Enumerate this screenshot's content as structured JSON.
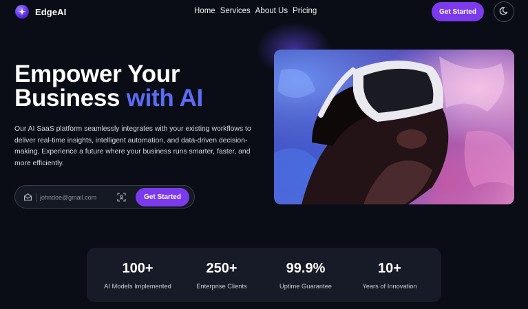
{
  "brand": {
    "name": "EdgeAI",
    "accent": "#7c3aed",
    "logo_icon": "sparkle-logo-icon"
  },
  "nav": {
    "links": [
      "Home",
      "Services",
      "About Us",
      "Pricing"
    ],
    "cta_label": "Get Started",
    "theme_icon": "moon-icon"
  },
  "hero": {
    "title_line1": "Empower Your",
    "title_line2": "Business",
    "title_accent": "with AI",
    "accent_color": "#5b6cf5",
    "description": "Our AI SaaS platform seamlessly integrates with your existing workflows to deliver real-time insights, intelligent automation, and data-driven decision-making. Experience a future where your business runs smarter, faster, and more efficiently.",
    "email_placeholder": "johndoe@gmail.com",
    "cta_label": "Get Started",
    "image_alt": "Person wearing a VR headset"
  },
  "stats": [
    {
      "value": "100+",
      "label": "AI Models Implemented"
    },
    {
      "value": "250+",
      "label": "Enterprise Clients"
    },
    {
      "value": "99.9%",
      "label": "Uptime Guarantee"
    },
    {
      "value": "10+",
      "label": "Years of Innovation"
    }
  ]
}
